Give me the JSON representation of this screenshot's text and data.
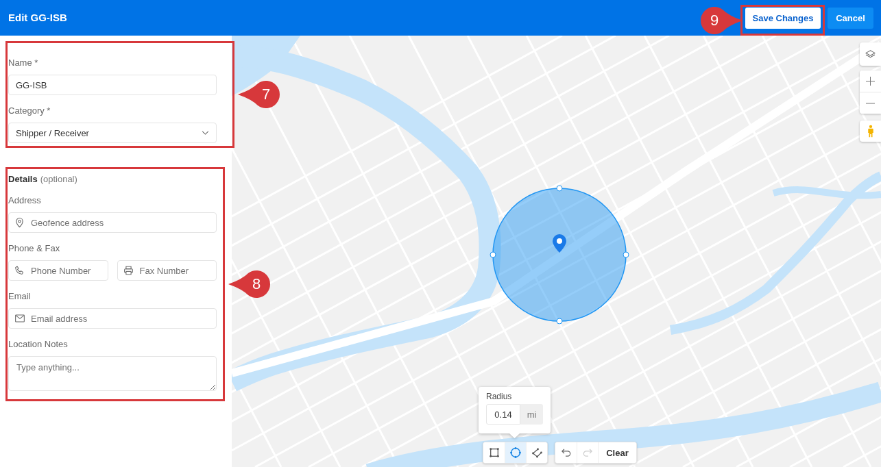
{
  "header": {
    "title": "Edit GG-ISB",
    "actions": [
      {
        "kind": "save",
        "label": "Save Changes",
        "callout": "9"
      },
      {
        "kind": "cancel",
        "label": "Cancel"
      }
    ]
  },
  "general": {
    "callout": "7",
    "fields": [
      {
        "kind": "text",
        "label": "Name *",
        "value": "GG-ISB"
      },
      {
        "kind": "select",
        "label": "Category *",
        "value": "Shipper / Receiver"
      }
    ]
  },
  "details": {
    "callout": "8",
    "title": "Details",
    "note": "(optional)",
    "groups": [
      {
        "label": "Address",
        "fields": [
          {
            "kind": "address",
            "placeholder": "Geofence address"
          }
        ]
      },
      {
        "label": "Phone & Fax",
        "fields": [
          {
            "kind": "phone",
            "placeholder": "Phone Number"
          },
          {
            "kind": "fax",
            "placeholder": "Fax Number"
          }
        ]
      },
      {
        "label": "Email",
        "fields": [
          {
            "kind": "email",
            "placeholder": "Email address"
          }
        ]
      },
      {
        "label": "Location Notes",
        "fields": [
          {
            "kind": "notes",
            "placeholder": "Type anything..."
          }
        ]
      }
    ]
  },
  "map": {
    "radius": {
      "label": "Radius",
      "value": "0.14",
      "unit": "mi"
    },
    "shape_tools": [
      {
        "kind": "rectangle",
        "selected": false
      },
      {
        "kind": "circle",
        "selected": true
      },
      {
        "kind": "polygon",
        "selected": false
      }
    ],
    "history": [
      {
        "kind": "undo",
        "disabled": false
      },
      {
        "kind": "redo",
        "disabled": true
      }
    ],
    "clear": "Clear"
  }
}
